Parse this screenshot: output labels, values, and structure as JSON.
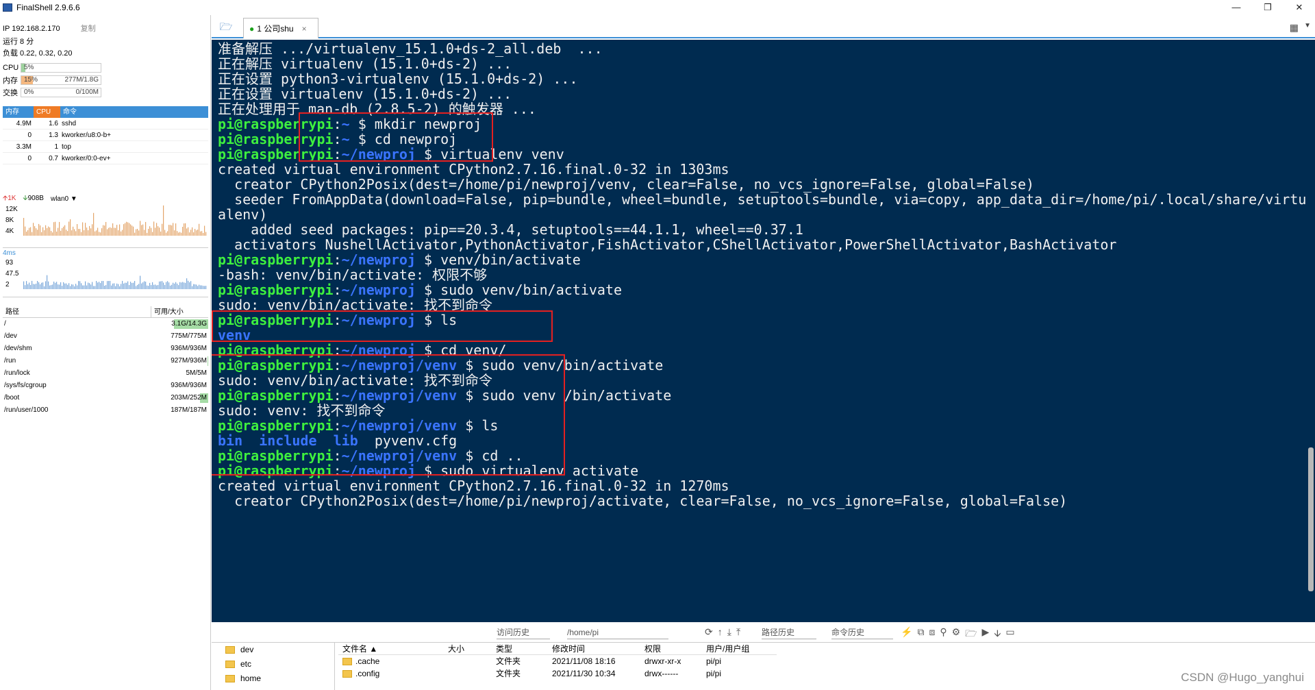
{
  "app": {
    "title": "FinalShell 2.9.6.6"
  },
  "sysinfo": {
    "ip": "IP 192.168.2.170",
    "copy": "复制",
    "uptime": "运行 8 分",
    "load": "负载 0.22, 0.32, 0.20",
    "cpu": {
      "label": "CPU",
      "pct": "5%",
      "value": 0.05
    },
    "mem": {
      "label": "内存",
      "pct": "15%",
      "amount": "277M/1.8G",
      "value": 0.15
    },
    "swap": {
      "label": "交换",
      "pct": "0%",
      "amount": "0/100M",
      "value": 0
    }
  },
  "processes": {
    "headers": [
      "内存",
      "CPU",
      "命令"
    ],
    "rows": [
      {
        "mem": "4.9M",
        "cpu": "1.6",
        "cmd": "sshd"
      },
      {
        "mem": "0",
        "cpu": "1.3",
        "cmd": "kworker/u8:0-b+"
      },
      {
        "mem": "3.3M",
        "cpu": "1",
        "cmd": "top"
      },
      {
        "mem": "0",
        "cpu": "0.7",
        "cmd": "kworker/0:0-ev+"
      }
    ]
  },
  "network": {
    "up": "1K",
    "down": "908B",
    "iface": "wlan0",
    "yticks": [
      "12K",
      "8K",
      "4K"
    ]
  },
  "ping": {
    "label": "4ms",
    "yticks": [
      "93",
      "47.5",
      "2"
    ]
  },
  "filesystems": {
    "headers": [
      "路径",
      "可用/大小"
    ],
    "rows": [
      {
        "path": "/",
        "size": "3.1G/14.3G",
        "used": 0.78
      },
      {
        "path": "/dev",
        "size": "775M/775M",
        "used": 0
      },
      {
        "path": "/dev/shm",
        "size": "936M/936M",
        "used": 0
      },
      {
        "path": "/run",
        "size": "927M/936M",
        "used": 0.01
      },
      {
        "path": "/run/lock",
        "size": "5M/5M",
        "used": 0
      },
      {
        "path": "/sys/fs/cgroup",
        "size": "936M/936M",
        "used": 0
      },
      {
        "path": "/boot",
        "size": "203M/252M",
        "used": 0.19
      },
      {
        "path": "/run/user/1000",
        "size": "187M/187M",
        "used": 0
      }
    ]
  },
  "tabs": [
    {
      "label": "1 公司shu",
      "close": "×"
    }
  ],
  "terminal": {
    "lines": [
      {
        "parts": [
          {
            "t": "准备解压 .../virtualenv_15.1.0+ds-2_all.deb  ..."
          }
        ]
      },
      {
        "parts": [
          {
            "t": "正在解压 virtualenv (15.1.0+ds-2) ..."
          }
        ]
      },
      {
        "parts": [
          {
            "t": "正在设置 python3-virtualenv (15.1.0+ds-2) ..."
          }
        ]
      },
      {
        "parts": [
          {
            "t": "正在设置 virtualenv (15.1.0+ds-2) ..."
          }
        ]
      },
      {
        "parts": [
          {
            "t": "正在处理用于 man-db (2.8.5-2) 的触发器 ..."
          }
        ]
      },
      {
        "parts": [
          {
            "t": "pi@raspberrypi",
            "c": "pr"
          },
          {
            "t": ":"
          },
          {
            "t": "~",
            "c": "pa"
          },
          {
            "t": " $ mkdir newproj"
          }
        ]
      },
      {
        "parts": [
          {
            "t": "pi@raspberrypi",
            "c": "pr"
          },
          {
            "t": ":"
          },
          {
            "t": "~",
            "c": "pa"
          },
          {
            "t": " $ cd newproj"
          }
        ]
      },
      {
        "parts": [
          {
            "t": "pi@raspberrypi",
            "c": "pr"
          },
          {
            "t": ":"
          },
          {
            "t": "~/newproj",
            "c": "pa"
          },
          {
            "t": " $ virtualenv venv"
          }
        ]
      },
      {
        "parts": [
          {
            "t": "created virtual environment CPython2.7.16.final.0-32 in 1303ms"
          }
        ]
      },
      {
        "parts": [
          {
            "t": "  creator CPython2Posix(dest=/home/pi/newproj/venv, clear=False, no_vcs_ignore=False, global=False)"
          }
        ]
      },
      {
        "parts": [
          {
            "t": "  seeder FromAppData(download=False, pip=bundle, wheel=bundle, setuptools=bundle, via=copy, app_data_dir=/home/pi/.local/share/virtu"
          }
        ]
      },
      {
        "parts": [
          {
            "t": "alenv)"
          }
        ]
      },
      {
        "parts": [
          {
            "t": "    added seed packages: pip==20.3.4, setuptools==44.1.1, wheel==0.37.1"
          }
        ]
      },
      {
        "parts": [
          {
            "t": "  activators NushellActivator,PythonActivator,FishActivator,CShellActivator,PowerShellActivator,BashActivator"
          }
        ]
      },
      {
        "parts": [
          {
            "t": "pi@raspberrypi",
            "c": "pr"
          },
          {
            "t": ":"
          },
          {
            "t": "~/newproj",
            "c": "pa"
          },
          {
            "t": " $ venv/bin/activate"
          }
        ]
      },
      {
        "parts": [
          {
            "t": "-bash: venv/bin/activate: 权限不够"
          }
        ]
      },
      {
        "parts": [
          {
            "t": "pi@raspberrypi",
            "c": "pr"
          },
          {
            "t": ":"
          },
          {
            "t": "~/newproj",
            "c": "pa"
          },
          {
            "t": " $ sudo venv/bin/activate"
          }
        ]
      },
      {
        "parts": [
          {
            "t": "sudo: venv/bin/activate: 找不到命令"
          }
        ]
      },
      {
        "parts": [
          {
            "t": "pi@raspberrypi",
            "c": "pr"
          },
          {
            "t": ":"
          },
          {
            "t": "~/newproj",
            "c": "pa"
          },
          {
            "t": " $ ls"
          }
        ]
      },
      {
        "parts": [
          {
            "t": "venv",
            "c": "blue"
          }
        ]
      },
      {
        "parts": [
          {
            "t": "pi@raspberrypi",
            "c": "pr"
          },
          {
            "t": ":"
          },
          {
            "t": "~/newproj",
            "c": "pa"
          },
          {
            "t": " $ cd venv/"
          }
        ]
      },
      {
        "parts": [
          {
            "t": "pi@raspberrypi",
            "c": "pr"
          },
          {
            "t": ":"
          },
          {
            "t": "~/newproj/venv",
            "c": "pa"
          },
          {
            "t": " $ sudo venv/bin/activate"
          }
        ]
      },
      {
        "parts": [
          {
            "t": "sudo: venv/bin/activate: 找不到命令"
          }
        ]
      },
      {
        "parts": [
          {
            "t": "pi@raspberrypi",
            "c": "pr"
          },
          {
            "t": ":"
          },
          {
            "t": "~/newproj/venv",
            "c": "pa"
          },
          {
            "t": " $ sudo venv /bin/activate"
          }
        ]
      },
      {
        "parts": [
          {
            "t": "sudo: venv: 找不到命令"
          }
        ]
      },
      {
        "parts": [
          {
            "t": "pi@raspberrypi",
            "c": "pr"
          },
          {
            "t": ":"
          },
          {
            "t": "~/newproj/venv",
            "c": "pa"
          },
          {
            "t": " $ ls"
          }
        ]
      },
      {
        "parts": [
          {
            "t": "bin",
            "c": "blue"
          },
          {
            "t": "  "
          },
          {
            "t": "include",
            "c": "blue"
          },
          {
            "t": "  "
          },
          {
            "t": "lib",
            "c": "blue"
          },
          {
            "t": "  pyvenv.cfg"
          }
        ]
      },
      {
        "parts": [
          {
            "t": "pi@raspberrypi",
            "c": "pr"
          },
          {
            "t": ":"
          },
          {
            "t": "~/newproj/venv",
            "c": "pa"
          },
          {
            "t": " $ cd .."
          }
        ]
      },
      {
        "parts": [
          {
            "t": "pi@raspberrypi",
            "c": "pr"
          },
          {
            "t": ":"
          },
          {
            "t": "~/newproj",
            "c": "pa"
          },
          {
            "t": " $ sudo virtualenv activate"
          }
        ]
      },
      {
        "parts": [
          {
            "t": "created virtual environment CPython2.7.16.final.0-32 in 1270ms"
          }
        ]
      },
      {
        "parts": [
          {
            "t": "  creator CPython2Posix(dest=/home/pi/newproj/activate, clear=False, no_vcs_ignore=False, global=False)"
          }
        ]
      }
    ]
  },
  "toolbar": {
    "history": "访问历史",
    "path": "/home/pi",
    "path_history": "路径历史",
    "cmd_history": "命令历史"
  },
  "filetree": [
    "dev",
    "etc",
    "home"
  ],
  "filetable": {
    "headers": [
      "文件名 ▲",
      "大小",
      "类型",
      "修改时间",
      "权限",
      "用户/用户组"
    ],
    "rows": [
      {
        "name": ".cache",
        "size": "",
        "type": "文件夹",
        "mtime": "2021/11/08 18:16",
        "perm": "drwxr-xr-x",
        "owner": "pi/pi"
      },
      {
        "name": ".config",
        "size": "",
        "type": "文件夹",
        "mtime": "2021/11/30 10:34",
        "perm": "drwx------",
        "owner": "pi/pi"
      }
    ]
  },
  "watermark": "CSDN @Hugo_yanghui"
}
